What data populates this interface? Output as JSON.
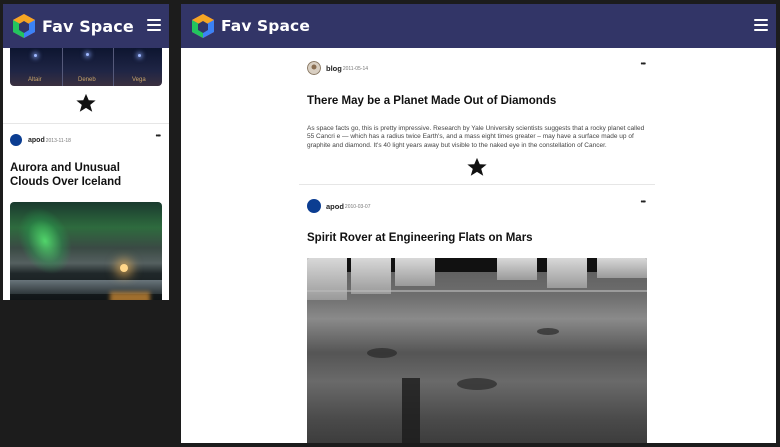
{
  "app": {
    "brand": "Fav Space"
  },
  "mobile": {
    "star_image": {
      "labels": [
        "Altair",
        "Deneb",
        "Vega"
      ]
    },
    "post": {
      "author": "apod",
      "date": "2013-11-18",
      "title": "Aurora and Unusual Clouds Over Iceland"
    }
  },
  "desktop": {
    "posts": [
      {
        "author": "blog",
        "date": "2011-05-14",
        "title": "There May be a Planet Made Out of Diamonds",
        "body": "As space facts go, this is pretty impressive. Research by Yale University scientists suggests that a rocky planet called 55 Cancri e — which has a radius twice Earth's, and a mass eight times greater – may have a surface made up of graphite and diamond. It's 40 light years away but visible to the naked eye in the constellation of Cancer."
      },
      {
        "author": "apod",
        "date": "2010-03-07",
        "title": "Spirit Rover at Engineering Flats on Mars"
      }
    ]
  },
  "icons": {
    "logo": "cube-logo-icon",
    "menu": "hamburger-menu-icon",
    "favorite": "star-icon",
    "more": "more-options-icon"
  },
  "colors": {
    "navbar": "#323567",
    "background": "#1c1c1c",
    "nasa_badge": "#0b3d91"
  }
}
